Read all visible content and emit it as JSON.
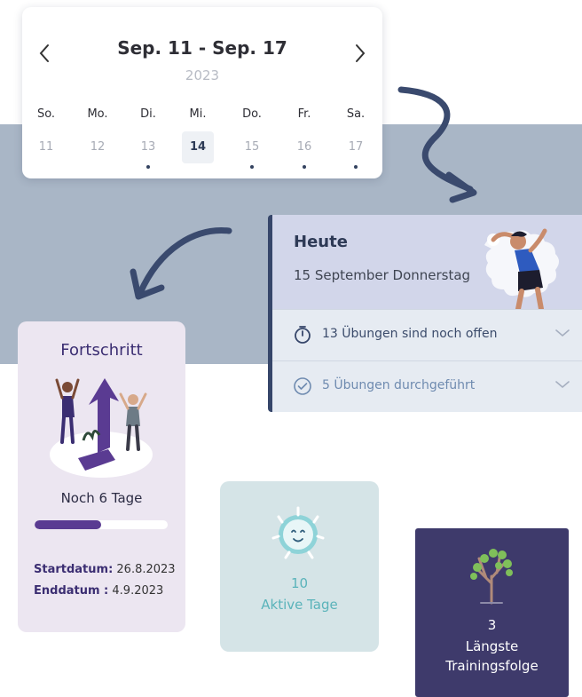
{
  "calendar": {
    "range": "Sep. 11 - Sep. 17",
    "year": "2023",
    "prev_icon": "chevron-left-icon",
    "next_icon": "chevron-right-icon",
    "weekdays": [
      "So.",
      "Mo.",
      "Di.",
      "Mi.",
      "Do.",
      "Fr.",
      "Sa."
    ],
    "days": [
      "11",
      "12",
      "13",
      "14",
      "15",
      "16",
      "17"
    ],
    "selected_day": "14",
    "days_with_dot": [
      "13",
      "15",
      "16",
      "17"
    ]
  },
  "today": {
    "title": "Heute",
    "date": "15 September Donnerstag",
    "open_exercises": "13 Übungen sind noch offen",
    "done_exercises": "5 Übungen durchgeführt",
    "open_icon": "stopwatch-icon",
    "done_icon": "check-circle-icon"
  },
  "progress": {
    "title": "Fortschritt",
    "remaining": "Noch 6 Tage",
    "bar_fraction": 0.5,
    "start_label": "Startdatum:",
    "start_value": " 26.8.2023",
    "end_label": "Enddatum :",
    "end_value": " 4.9.2023"
  },
  "active_days": {
    "count": "10",
    "label": "Aktive Tage"
  },
  "streak": {
    "count": "3",
    "label_line1": "Längste",
    "label_line2": "Trainingsfolge"
  },
  "colors": {
    "band": "#a9b6c6",
    "navy": "#36466a",
    "purple": "#5a3b92",
    "teal": "#5ab3ba",
    "streak_bg": "#3e3a6b"
  }
}
